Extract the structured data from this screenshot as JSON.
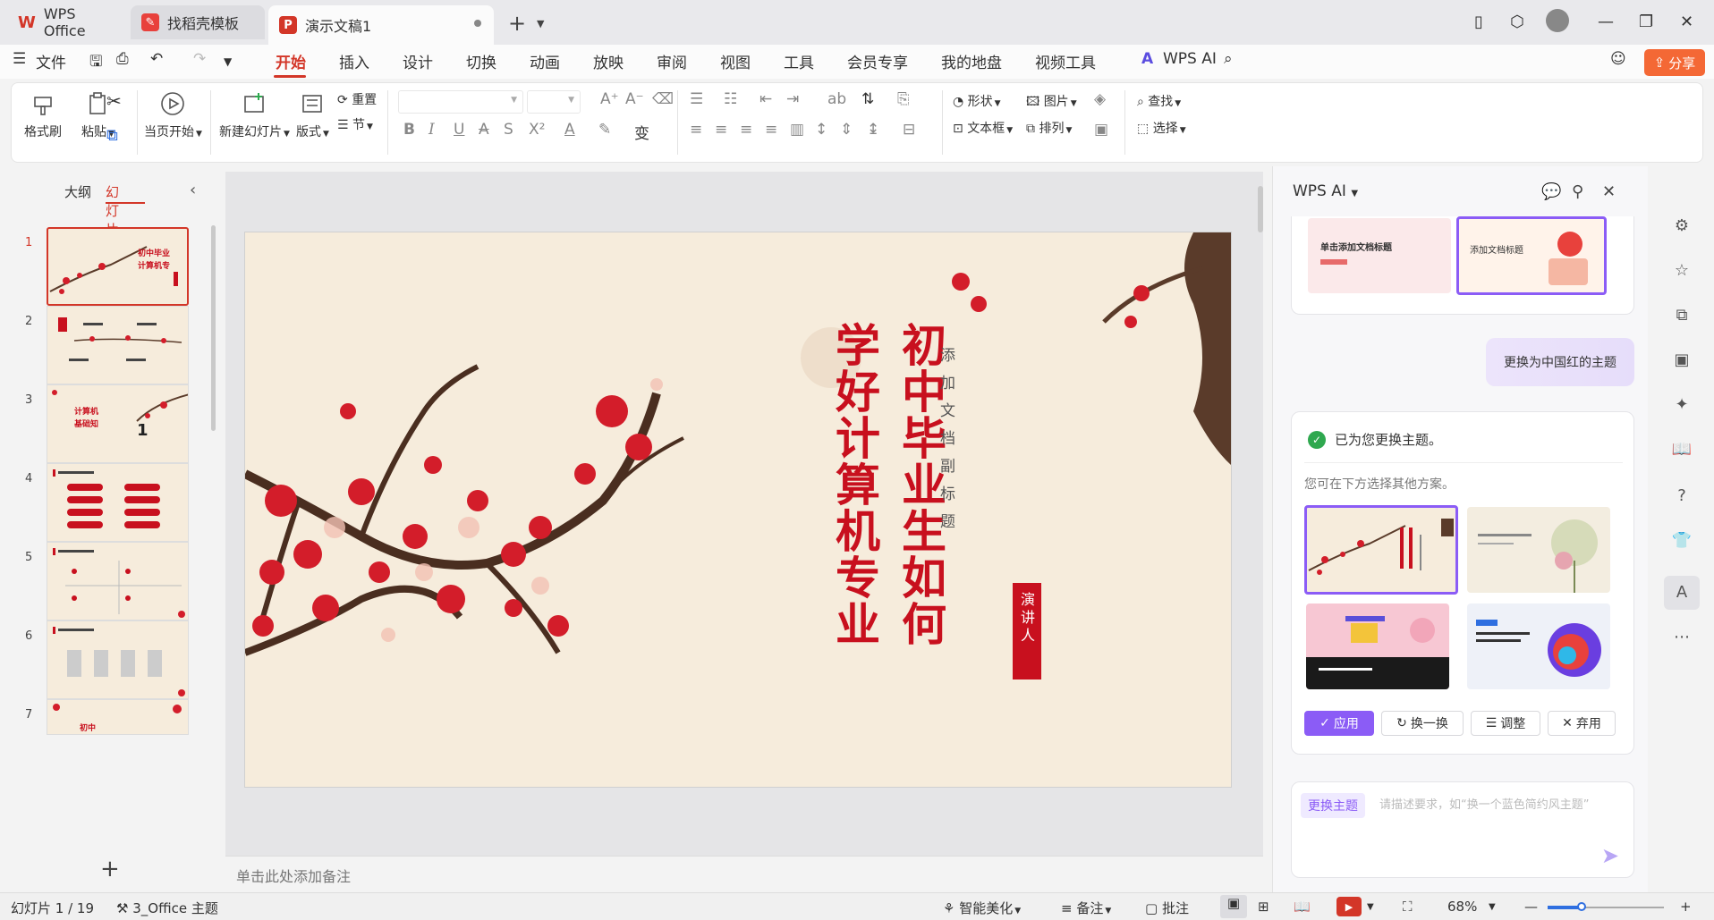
{
  "tabs": [
    {
      "label": "WPS Office"
    },
    {
      "label": "找稻壳模板"
    },
    {
      "label": "演示文稿1"
    }
  ],
  "menu": [
    "文件",
    "开始",
    "插入",
    "设计",
    "切换",
    "动画",
    "放映",
    "审阅",
    "视图",
    "工具",
    "会员专享",
    "我的地盘",
    "视频工具",
    "WPS AI"
  ],
  "share_label": "分享",
  "ribbon": {
    "format_painter": "格式刷",
    "paste": "粘贴",
    "from_current": "当页开始",
    "new_slide": "新建幻灯片",
    "layout": "版式",
    "reset": "重置",
    "section": "节",
    "shape": "形状",
    "picture": "图片",
    "find": "查找",
    "textbox": "文本框",
    "arrange": "排列",
    "select": "选择"
  },
  "left_panel": {
    "outline_tab": "大纲",
    "slides_tab": "幻灯片",
    "slide_numbers": [
      "1",
      "2",
      "3",
      "4",
      "5",
      "6",
      "7"
    ],
    "thumb3_number": "1"
  },
  "slide": {
    "title_line1": "初中毕业生如何",
    "title_line2": "学好计算机专业",
    "subtitle": "添加文档副标题",
    "presenter": "演讲人"
  },
  "notes_placeholder": "单击此处添加备注",
  "ai_panel": {
    "title": "WPS AI",
    "top_card_left_title": "单击添加文档标题",
    "top_card_right_title": "添加文档标题",
    "user_message": "更换为中国红的主题",
    "done_message": "已为您更换主题。",
    "hint": "您可在下方选择其他方案。",
    "apply": "应用",
    "swap": "换一换",
    "adjust": "调整",
    "discard": "弃用",
    "input_tag": "更换主题",
    "input_placeholder": "请描述要求，如“换一个蓝色简约风主题”"
  },
  "status": {
    "slide_count": "幻灯片 1 / 19",
    "theme": "3_Office 主题",
    "smart_beautify": "智能美化",
    "notes": "备注",
    "comments": "批注",
    "zoom": "68%",
    "zoom_fraction": 0.3
  },
  "colors": {
    "accent_red": "#d33628",
    "slide_red": "#c8101e",
    "ai_purple": "#8b5cf6",
    "slide_bg": "#f6ecdc"
  }
}
